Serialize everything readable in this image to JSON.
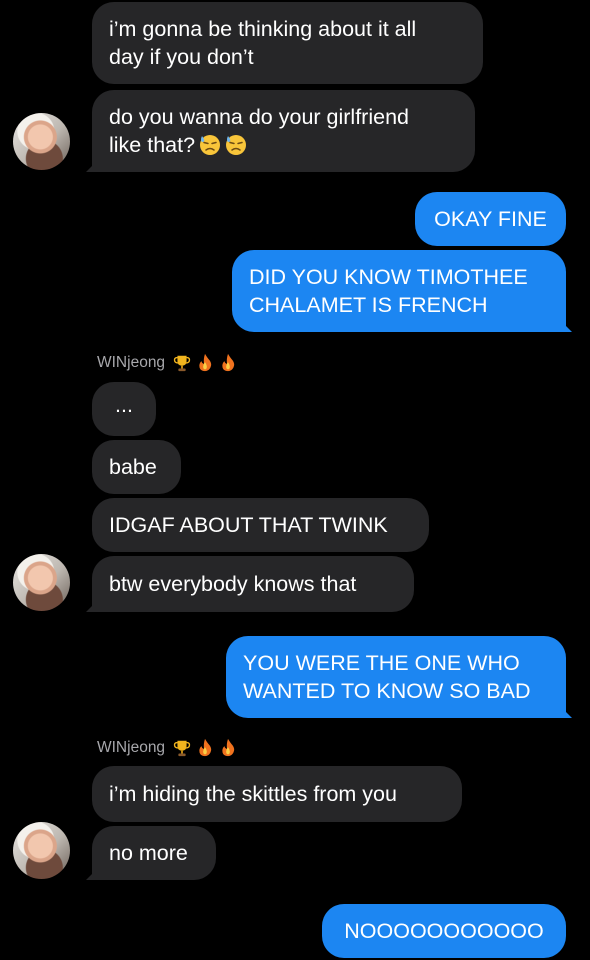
{
  "messages": {
    "m1_line1": "i’m gonna be thinking about it all",
    "m1_line2": "day if you don’t",
    "m2_line1": "do you wanna do your girlfriend",
    "m2_line2": "like that?",
    "m3": "OKAY FINE",
    "m4_line1": "DID YOU KNOW TIMOTHEE",
    "m4_line2": "CHALAMET IS FRENCH",
    "m5": "...",
    "m6": "babe",
    "m7": "IDGAF ABOUT THAT TWINK",
    "m8": "btw everybody knows that",
    "m9_line1": "YOU WERE THE ONE WHO",
    "m9_line2": "WANTED TO KNOW SO BAD",
    "m10": "i’m hiding the skittles from you",
    "m11": "no more",
    "m12": "NOOOOOOOOOOO"
  },
  "senders": {
    "s1": "WINjeong",
    "s2": "WINjeong"
  },
  "emoji": {
    "sweat": "downcast-face-with-sweat-icon",
    "trophy": "trophy-icon",
    "fire": "fire-icon"
  },
  "colors": {
    "background": "#000000",
    "incoming_bubble": "#262628",
    "outgoing_bubble": "#1c86f2",
    "sender_label": "#a7a7ab"
  }
}
